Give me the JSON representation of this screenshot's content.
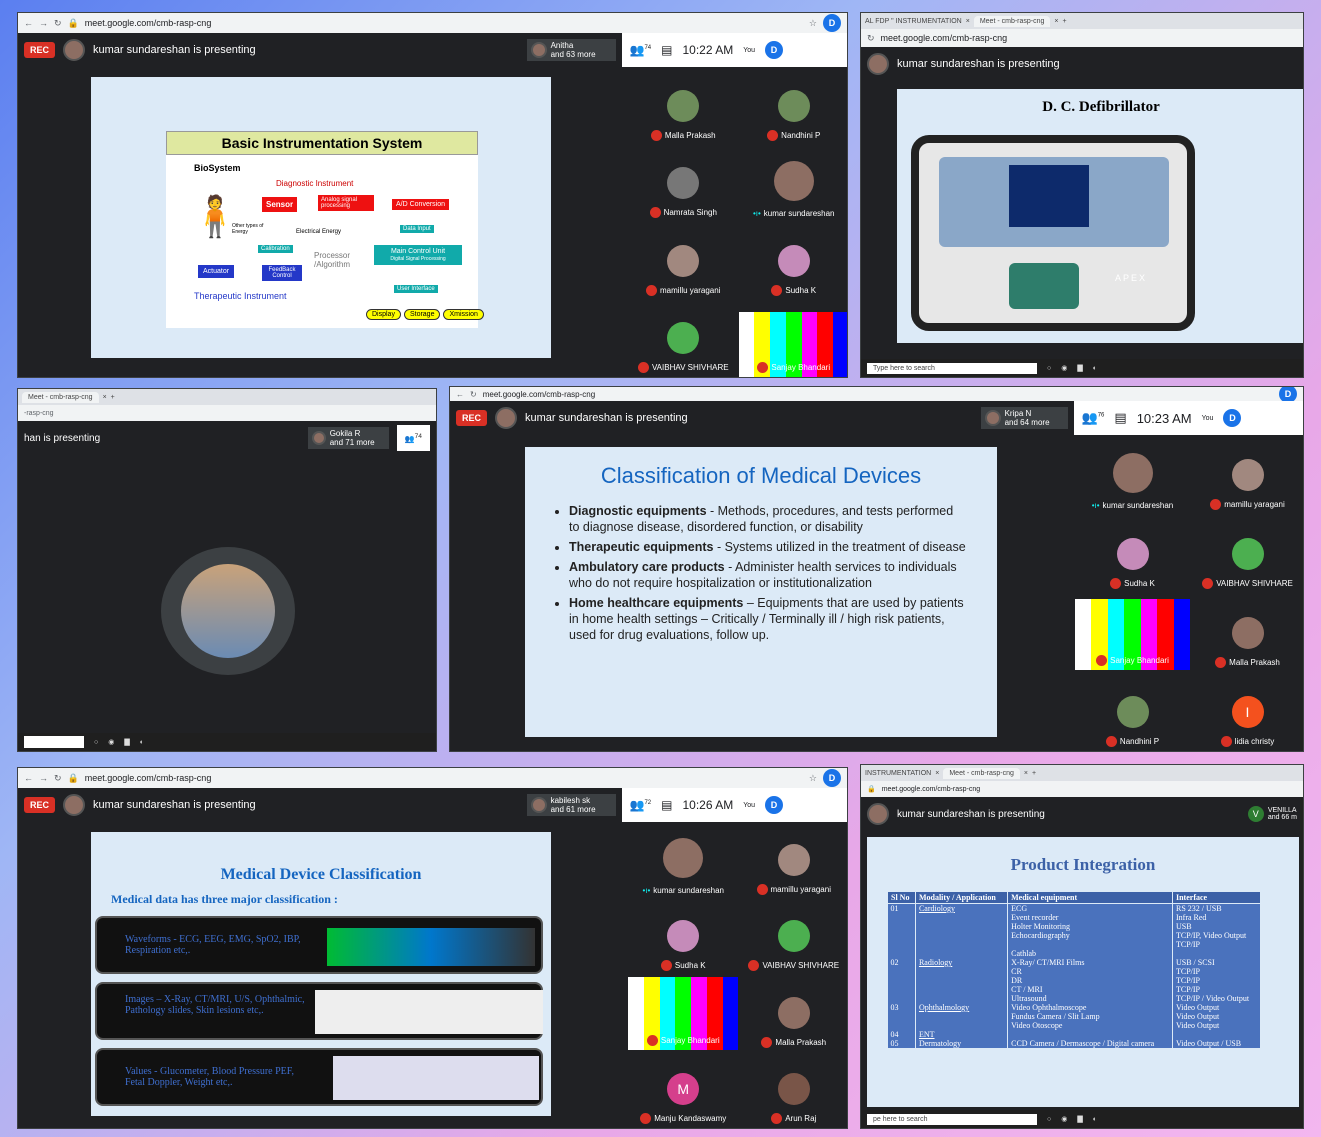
{
  "browser": {
    "url": "meet.google.com/cmb-rasp-cng",
    "tab1": "AL FDP \" INSTRUMENTATION",
    "tab2": "Meet - cmb-rasp-cng",
    "tab3": "Meet - cmb-rasp-cng",
    "tab4": "INSTRUMENTATION",
    "rec": "REC",
    "presenting": "kumar sundareshan is presenting",
    "presenting_cut": "han is presenting",
    "you": "You",
    "avatar_letter": "D",
    "taskbar_search": "Type here to search",
    "taskbar_search_cut": "pe here to search"
  },
  "p1": {
    "extra": "Anitha",
    "extra_more": "and 63 more",
    "count": "74",
    "time": "10:22 AM"
  },
  "p1_slide": {
    "title": "Basic Instrumentation System",
    "biosystem": "BioSystem",
    "diag": "Diagnostic Instrument",
    "sensor": "Sensor",
    "analog": "Analog signal processing",
    "adc": "A/D Conversion",
    "other": "Other types of Energy",
    "electrical": "Electrical Energy",
    "data_input": "Data Input",
    "calibration": "Calibration",
    "processor": "Processor /Algorithm",
    "mcu": "Main Control Unit",
    "dsp": "Digital Signal Processing",
    "actuator": "Actuator",
    "feedback": "FeedBack Control",
    "user": "User Interface",
    "therapeutic": "Therapeutic Instrument",
    "display": "Display",
    "storage": "Storage",
    "xmission": "Xmission",
    "target": "target"
  },
  "p1_participants": [
    "Malla Prakash",
    "Nandhini P",
    "Namrata Singh",
    "kumar sundareshan",
    "mamillu yaragani",
    "Sudha K",
    "VAIBHAV SHIVHARE",
    "Sanjay Bhandari"
  ],
  "p2_slide": {
    "title": "D. C. Defibrillator",
    "brand": "APEX"
  },
  "p3": {
    "extra": "Gokila R",
    "extra_more": "and 71 more",
    "count": "74"
  },
  "p4": {
    "extra": "Kripa N",
    "extra_more": "and 64 more",
    "count": "76",
    "time": "10:23 AM"
  },
  "p4_slide": {
    "title": "Classification of Medical Devices",
    "items": [
      {
        "b": "Diagnostic equipments",
        "t": " - Methods, procedures, and tests performed to diagnose disease, disordered function, or disability"
      },
      {
        "b": "Therapeutic equipments",
        "t": " - Systems utilized in the treatment of disease"
      },
      {
        "b": "Ambulatory care products",
        "t": " - Administer health services to individuals who do not require hospitalization or institutionalization"
      },
      {
        "b": "Home healthcare equipments",
        "t": " – Equipments that are used by patients in home health settings – Critically / Terminally ill / high risk  patients, used for drug evaluations, follow up."
      }
    ]
  },
  "p4_participants": [
    "kumar sundareshan",
    "mamillu yaragani",
    "Sudha K",
    "VAIBHAV SHIVHARE",
    "Sanjay Bhandari",
    "Malla Prakash",
    "Nandhini P",
    "lidia christy"
  ],
  "p4_initial": "I",
  "p5": {
    "extra": "kabilesh sk",
    "extra_more": "and 61 more",
    "count": "72",
    "time": "10:26 AM"
  },
  "p5_slide": {
    "title": "Medical Device Classification",
    "subtitle": "Medical data has three major classification :",
    "rows": [
      "Waveforms  - ECG, EEG, EMG, SpO2, IBP,  Respiration etc,.",
      "Images – X-Ray, CT/MRI, U/S, Ophthalmic, Pathology slides, Skin lesions etc,.",
      "Values  - Glucometer, Blood Pressure PEF,  Fetal Doppler, Weight etc,."
    ]
  },
  "p5_participants": [
    "kumar sundareshan",
    "mamillu yaragani",
    "Sudha K",
    "VAIBHAV SHIVHARE",
    "Sanjay Bhandari",
    "Malla Prakash",
    "Manju Kandaswamy",
    "Arun Raj"
  ],
  "p5_initial": "M",
  "p6": {
    "extra": "VENILLA",
    "extra_more": "and 66 m",
    "initial": "V"
  },
  "p6_slide": {
    "title": "Product Integration",
    "headers": [
      "Sl No",
      "Modality / Application",
      "Medical equipment",
      "Interface"
    ],
    "rows": [
      [
        "01",
        "Cardiology",
        "ECG\nEvent recorder\nHolter Monitoring\nEchocardiography\n\nCathlab",
        "RS 232 / USB\nInfra Red\nUSB\nTCP/IP, Video Output\nTCP/IP"
      ],
      [
        "02",
        "Radiology",
        "X-Ray/ CT/MRI Films\nCR\nDR\nCT / MRI\nUltrasound",
        "USB / SCSI\nTCP/IP\nTCP/IP\nTCP/IP\nTCP/IP / Video Output"
      ],
      [
        "03",
        "Ophthalmology",
        "Video Ophthalmoscope\nFundus Camera / Slit Lamp\nVideo Otoscope",
        "Video Output\nVideo Output\nVideo Output"
      ],
      [
        "04",
        "ENT",
        "",
        ""
      ],
      [
        "05",
        "Dermatology",
        "CCD Camera / Dermascope / Digital camera",
        "Video Output / USB"
      ]
    ]
  },
  "colors": {
    "accent": "#1a73e8",
    "rec": "#d93025",
    "slide_title": "#1565c0"
  }
}
